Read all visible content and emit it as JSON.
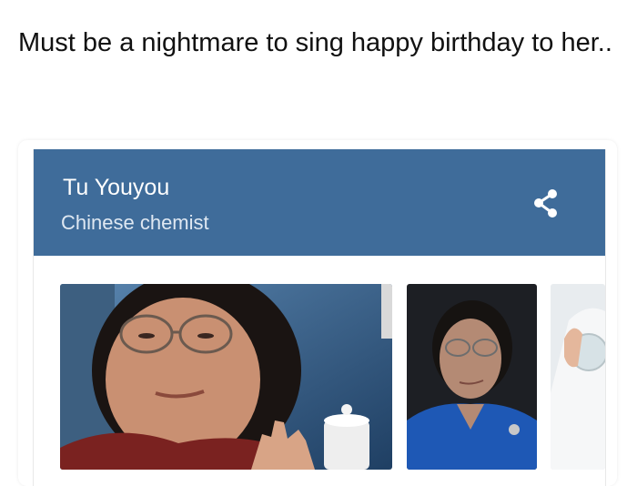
{
  "post": {
    "caption": "Must be a nightmare to sing happy birthday to her.."
  },
  "knowledge_card": {
    "title": "Tu Youyou",
    "subtitle": "Chinese chemist",
    "share_icon": "share-icon"
  },
  "colors": {
    "header_bg": "#3f6c9a",
    "title_text": "#ffffff",
    "subtitle_text": "#dfe8f2"
  }
}
